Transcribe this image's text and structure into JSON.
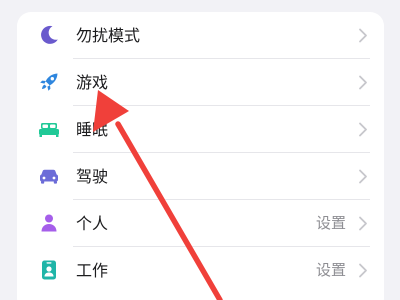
{
  "colors": {
    "page_background": "#f2f2f6",
    "card_background": "#ffffff",
    "moon_icon": "#6a5acd",
    "rocket_icon": "#2e86de",
    "bed_icon": "#20c997",
    "car_icon": "#6c6cd8",
    "person_icon": "#a55eea",
    "badge_icon": "#1fb5a8",
    "chevron": "#c7c7cc",
    "annotation_arrow": "#f0403a"
  },
  "settings_list": {
    "items": [
      {
        "label": "勿扰模式",
        "value": "",
        "icon": "moon-icon"
      },
      {
        "label": "游戏",
        "value": "",
        "icon": "rocket-icon"
      },
      {
        "label": "睡眠",
        "value": "",
        "icon": "bed-icon"
      },
      {
        "label": "驾驶",
        "value": "",
        "icon": "car-icon"
      },
      {
        "label": "个人",
        "value": "设置",
        "icon": "person-icon"
      },
      {
        "label": "工作",
        "value": "设置",
        "icon": "work-badge-icon"
      }
    ]
  },
  "annotation": {
    "type": "arrow",
    "points_to": "游戏"
  }
}
